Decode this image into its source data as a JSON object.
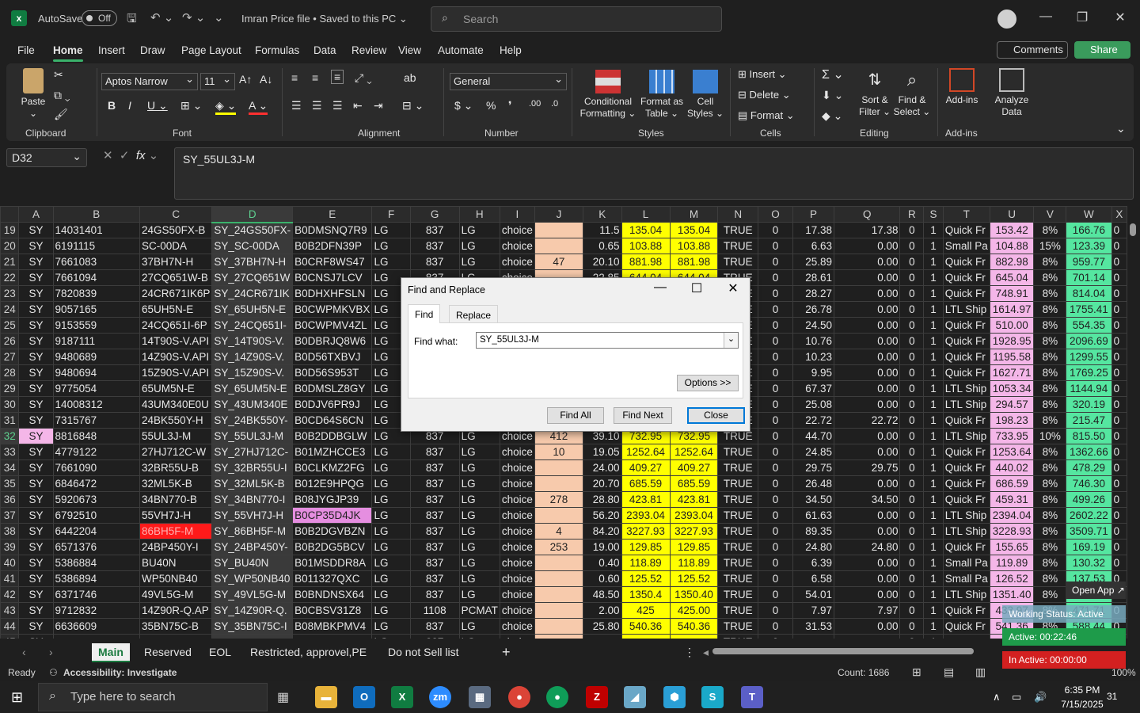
{
  "titlebar": {
    "autosave_label": "AutoSave",
    "autosave_state": "Off",
    "doc_title": "Imran Price file • Saved to this PC ⌄",
    "search_placeholder": "Search"
  },
  "menu": {
    "items": [
      "File",
      "Home",
      "Insert",
      "Draw",
      "Page Layout",
      "Formulas",
      "Data",
      "Review",
      "View",
      "Automate",
      "Help"
    ],
    "comments": "Comments",
    "share": "Share"
  },
  "ribbon": {
    "groups": {
      "clipboard": "Clipboard",
      "font": "Font",
      "alignment": "Alignment",
      "number": "Number",
      "styles": "Styles",
      "cells": "Cells",
      "editing": "Editing",
      "addins": "Add-ins"
    },
    "paste": "Paste",
    "font_name": "Aptos Narrow",
    "font_size": "11",
    "number_format": "General",
    "conditional_formatting": "Conditional Formatting ⌄",
    "format_as_table": "Format as Table ⌄",
    "cell_styles": "Cell Styles ⌄",
    "insert": "Insert",
    "delete": "Delete",
    "format": "Format ⌄",
    "sort_filter": "Sort & Filter ⌄",
    "find_select": "Find & Select ⌄",
    "addins_btn": "Add-ins",
    "analyze_data": "Analyze Data"
  },
  "formula": {
    "namebox": "D32",
    "content": "SY_55UL3J-M"
  },
  "columns": [
    "A",
    "B",
    "C",
    "D",
    "E",
    "F",
    "G",
    "H",
    "I",
    "J",
    "K",
    "L",
    "M",
    "N",
    "O",
    "P",
    "Q",
    "R",
    "S",
    "T",
    "U",
    "V",
    "W",
    "X"
  ],
  "rows": [
    {
      "n": "19",
      "c": [
        "SY",
        "14031401",
        "24GS50FX-B",
        "SY_24GS50FX-",
        "B0DMSNQ7R9",
        "LG",
        "837",
        "LG",
        "choice",
        "",
        "11.5",
        "135.04",
        "135.04",
        "TRUE",
        "0",
        "17.38",
        "17.38",
        "0",
        "1",
        "Quick Fr",
        "153.42",
        "8%",
        "166.76",
        "0"
      ]
    },
    {
      "n": "20",
      "c": [
        "SY",
        "6191115",
        "SC-00DA",
        "SY_SC-00DA",
        "B0B2DFN39P",
        "LG",
        "837",
        "LG",
        "choice",
        "",
        "0.65",
        "103.88",
        "103.88",
        "TRUE",
        "0",
        "6.63",
        "0.00",
        "0",
        "1",
        "Small Pa",
        "104.88",
        "15%",
        "123.39",
        "0"
      ]
    },
    {
      "n": "21",
      "c": [
        "SY",
        "7661083",
        "37BH7N-H",
        "SY_37BH7N-H",
        "B0CRF8WS47",
        "LG",
        "837",
        "LG",
        "choice",
        "47",
        "20.10",
        "881.98",
        "881.98",
        "TRUE",
        "0",
        "25.89",
        "0.00",
        "0",
        "1",
        "Quick Fr",
        "882.98",
        "8%",
        "959.77",
        "0"
      ]
    },
    {
      "n": "22",
      "c": [
        "SY",
        "7661094",
        "27CQ651W-B",
        "SY_27CQ651W",
        "B0CNSJ7LCV",
        "LG",
        "837",
        "LG",
        "choice",
        "",
        "22.85",
        "644.04",
        "644.04",
        "TRUE",
        "0",
        "28.61",
        "0.00",
        "0",
        "1",
        "Quick Fr",
        "645.04",
        "8%",
        "701.14",
        "0"
      ]
    },
    {
      "n": "23",
      "c": [
        "SY",
        "7820839",
        "24CR671IK6P",
        "SY_24CR671IK",
        "B0DHXHFSLN",
        "LG",
        "837",
        "LG",
        "choice",
        "",
        "",
        "",
        "",
        "TRUE",
        "0",
        "28.27",
        "0.00",
        "0",
        "1",
        "Quick Fr",
        "748.91",
        "8%",
        "814.04",
        "0"
      ]
    },
    {
      "n": "24",
      "c": [
        "SY",
        "9057165",
        "65UH5N-E",
        "SY_65UH5N-E",
        "B0CWPMKVBX",
        "LG",
        "837",
        "LG",
        "choice",
        "",
        "",
        "",
        "",
        "TRUE",
        "0",
        "26.78",
        "0.00",
        "0",
        "1",
        "LTL Ship",
        "1614.97",
        "8%",
        "1755.41",
        "0"
      ]
    },
    {
      "n": "25",
      "c": [
        "SY",
        "9153559",
        "24CQ651I-6P",
        "SY_24CQ651I-",
        "B0CWPMV4ZL",
        "LG",
        "837",
        "LG",
        "choice",
        "",
        "",
        "",
        "",
        "TRUE",
        "0",
        "24.50",
        "0.00",
        "0",
        "1",
        "Quick Fr",
        "510.00",
        "8%",
        "554.35",
        "0"
      ]
    },
    {
      "n": "26",
      "c": [
        "SY",
        "9187111",
        "14T90S-V.API",
        "SY_14T90S-V.",
        "B0DBRJQ8W6",
        "LG",
        "837",
        "LG",
        "choice",
        "",
        "",
        "",
        "",
        "TRUE",
        "0",
        "10.76",
        "0.00",
        "0",
        "1",
        "Quick Fr",
        "1928.95",
        "8%",
        "2096.69",
        "0"
      ]
    },
    {
      "n": "27",
      "c": [
        "SY",
        "9480689",
        "14Z90S-V.API",
        "SY_14Z90S-V.",
        "B0D56TXBVJ",
        "LG",
        "837",
        "LG",
        "choice",
        "",
        "",
        "",
        "",
        "TRUE",
        "0",
        "10.23",
        "0.00",
        "0",
        "1",
        "Quick Fr",
        "1195.58",
        "8%",
        "1299.55",
        "0"
      ]
    },
    {
      "n": "28",
      "c": [
        "SY",
        "9480694",
        "15Z90S-V.API",
        "SY_15Z90S-V.",
        "B0D56S953T",
        "LG",
        "837",
        "LG",
        "choice",
        "",
        "",
        "",
        "",
        "TRUE",
        "0",
        "9.95",
        "0.00",
        "0",
        "1",
        "Quick Fr",
        "1627.71",
        "8%",
        "1769.25",
        "0"
      ]
    },
    {
      "n": "29",
      "c": [
        "SY",
        "9775054",
        "65UM5N-E",
        "SY_65UM5N-E",
        "B0DMSLZ8GY",
        "LG",
        "837",
        "LG",
        "choice",
        "",
        "",
        "",
        "",
        "TRUE",
        "0",
        "67.37",
        "0.00",
        "0",
        "1",
        "LTL Ship",
        "1053.34",
        "8%",
        "1144.94",
        "0"
      ]
    },
    {
      "n": "30",
      "c": [
        "SY",
        "14008312",
        "43UM340E0U",
        "SY_43UM340E",
        "B0DJV6PR9J",
        "LG",
        "837",
        "LG",
        "choice",
        "",
        "",
        "",
        "",
        "TRUE",
        "0",
        "25.08",
        "0.00",
        "0",
        "1",
        "LTL Ship",
        "294.57",
        "8%",
        "320.19",
        "0"
      ]
    },
    {
      "n": "31",
      "c": [
        "SY",
        "7315767",
        "24BK550Y-H",
        "SY_24BK550Y-",
        "B0CD64S6CN",
        "LG",
        "837",
        "LG",
        "choice",
        "",
        "",
        "",
        "",
        "TRUE",
        "0",
        "22.72",
        "22.72",
        "0",
        "1",
        "Quick Fr",
        "198.23",
        "8%",
        "215.47",
        "0"
      ]
    },
    {
      "n": "32",
      "c": [
        "SY",
        "8816848",
        "55UL3J-M",
        "SY_55UL3J-M",
        "B0B2DDBGLW",
        "LG",
        "837",
        "LG",
        "choice",
        "412",
        "39.10",
        "732.95",
        "732.95",
        "TRUE",
        "0",
        "44.70",
        "0.00",
        "0",
        "1",
        "LTL Ship",
        "733.95",
        "10%",
        "815.50",
        "0"
      ]
    },
    {
      "n": "33",
      "c": [
        "SY",
        "4779122",
        "27HJ712C-W",
        "SY_27HJ712C-",
        "B01MZHCCE3",
        "LG",
        "837",
        "LG",
        "choice",
        "10",
        "19.05",
        "1252.64",
        "1252.64",
        "TRUE",
        "0",
        "24.85",
        "0.00",
        "0",
        "1",
        "Quick Fr",
        "1253.64",
        "8%",
        "1362.66",
        "0"
      ]
    },
    {
      "n": "34",
      "c": [
        "SY",
        "7661090",
        "32BR55U-B",
        "SY_32BR55U-I",
        "B0CLKMZ2FG",
        "LG",
        "837",
        "LG",
        "choice",
        "",
        "24.00",
        "409.27",
        "409.27",
        "TRUE",
        "0",
        "29.75",
        "29.75",
        "0",
        "1",
        "Quick Fr",
        "440.02",
        "8%",
        "478.29",
        "0"
      ]
    },
    {
      "n": "35",
      "c": [
        "SY",
        "6846472",
        "32ML5K-B",
        "SY_32ML5K-B",
        "B012E9HPQG",
        "LG",
        "837",
        "LG",
        "choice",
        "",
        "20.70",
        "685.59",
        "685.59",
        "TRUE",
        "0",
        "26.48",
        "0.00",
        "0",
        "1",
        "Quick Fr",
        "686.59",
        "8%",
        "746.30",
        "0"
      ]
    },
    {
      "n": "36",
      "c": [
        "SY",
        "5920673",
        "34BN770-B",
        "SY_34BN770-I",
        "B08JYGJP39",
        "LG",
        "837",
        "LG",
        "choice",
        "278",
        "28.80",
        "423.81",
        "423.81",
        "TRUE",
        "0",
        "34.50",
        "34.50",
        "0",
        "1",
        "Quick Fr",
        "459.31",
        "8%",
        "499.26",
        "0"
      ]
    },
    {
      "n": "37",
      "c": [
        "SY",
        "6792510",
        "55VH7J-H",
        "SY_55VH7J-H",
        "B0CP35D4JK",
        "LG",
        "837",
        "LG",
        "choice",
        "",
        "56.20",
        "2393.04",
        "2393.04",
        "TRUE",
        "0",
        "61.63",
        "0.00",
        "0",
        "1",
        "LTL Ship",
        "2394.04",
        "8%",
        "2602.22",
        "0"
      ]
    },
    {
      "n": "38",
      "c": [
        "SY",
        "6442204",
        "86BH5F-M",
        "SY_86BH5F-M",
        "B0B2DGVBZN",
        "LG",
        "837",
        "LG",
        "choice",
        "4",
        "84.20",
        "3227.93",
        "3227.93",
        "TRUE",
        "0",
        "89.35",
        "0.00",
        "0",
        "1",
        "LTL Ship",
        "3228.93",
        "8%",
        "3509.71",
        "0"
      ]
    },
    {
      "n": "39",
      "c": [
        "SY",
        "6571376",
        "24BP450Y-I",
        "SY_24BP450Y-",
        "B0B2DG5BCV",
        "LG",
        "837",
        "LG",
        "choice",
        "253",
        "19.00",
        "129.85",
        "129.85",
        "TRUE",
        "0",
        "24.80",
        "24.80",
        "0",
        "1",
        "Quick Fr",
        "155.65",
        "8%",
        "169.19",
        "0"
      ]
    },
    {
      "n": "40",
      "c": [
        "SY",
        "5386884",
        "BU40N",
        "SY_BU40N",
        "B01MSDDR8A",
        "LG",
        "837",
        "LG",
        "choice",
        "",
        "0.40",
        "118.89",
        "118.89",
        "TRUE",
        "0",
        "6.39",
        "0.00",
        "0",
        "1",
        "Small Pa",
        "119.89",
        "8%",
        "130.32",
        "0"
      ]
    },
    {
      "n": "41",
      "c": [
        "SY",
        "5386894",
        "WP50NB40",
        "SY_WP50NB40",
        "B011327QXC",
        "LG",
        "837",
        "LG",
        "choice",
        "",
        "0.60",
        "125.52",
        "125.52",
        "TRUE",
        "0",
        "6.58",
        "0.00",
        "0",
        "1",
        "Small Pa",
        "126.52",
        "8%",
        "137.53",
        "0"
      ]
    },
    {
      "n": "42",
      "c": [
        "SY",
        "6371746",
        "49VL5G-M",
        "SY_49VL5G-M",
        "B0BNDNSX64",
        "LG",
        "837",
        "LG",
        "choice",
        "",
        "48.50",
        "1350.4",
        "1350.40",
        "TRUE",
        "0",
        "54.01",
        "0.00",
        "0",
        "1",
        "LTL Ship",
        "1351.40",
        "8%",
        "1468.91",
        "0"
      ]
    },
    {
      "n": "43",
      "c": [
        "SY",
        "9712832",
        "14Z90R-Q.AP",
        "SY_14Z90R-Q.",
        "B0CBSV31Z8",
        "LG",
        "1108",
        "PCMAT",
        "choice",
        "",
        "2.00",
        "425",
        "425.00",
        "TRUE",
        "0",
        "7.97",
        "7.97",
        "0",
        "1",
        "Quick Fr",
        "433.97",
        "8%",
        "471.71",
        "0"
      ]
    },
    {
      "n": "44",
      "c": [
        "SY",
        "6636609",
        "35BN75C-B",
        "SY_35BN75C-I",
        "B08MBKPMV4",
        "LG",
        "837",
        "LG",
        "choice",
        "",
        "25.80",
        "540.36",
        "540.36",
        "TRUE",
        "0",
        "31.53",
        "0.00",
        "0",
        "1",
        "Quick Fr",
        "541.36",
        "8%",
        "588.44",
        "0"
      ]
    },
    {
      "n": "45",
      "c": [
        "SY",
        "",
        "",
        "",
        "",
        "LG",
        "837",
        "LG",
        "choice",
        "",
        "",
        "",
        "",
        "TRUE",
        "0",
        "",
        "",
        "0",
        "1",
        "",
        "",
        "",
        "",
        "0"
      ]
    }
  ],
  "dialog": {
    "title": "Find and Replace",
    "tab_find": "Find",
    "tab_replace": "Replace",
    "find_label": "Find what:",
    "find_value": "SY_55UL3J-M",
    "options": "Options >>",
    "find_all": "Find All",
    "find_next": "Find Next",
    "close": "Close"
  },
  "sheets": [
    "Main",
    "Reserved",
    "EOL",
    "Restricted, approvel,PE",
    "Do not Sell list"
  ],
  "status": {
    "ready": "Ready",
    "accessibility": "Accessibility: Investigate",
    "count": "Count: 1686",
    "zoom": "100%"
  },
  "overlay": {
    "open_app": "Open App ↗",
    "working": "Working Status: Active",
    "active": "Active: 00:22:46",
    "inactive": "In Active: 00:00:00"
  },
  "taskbar": {
    "search": "Type here to search",
    "time": "6:35 PM",
    "date": "7/15/2025",
    "notif": "31"
  }
}
